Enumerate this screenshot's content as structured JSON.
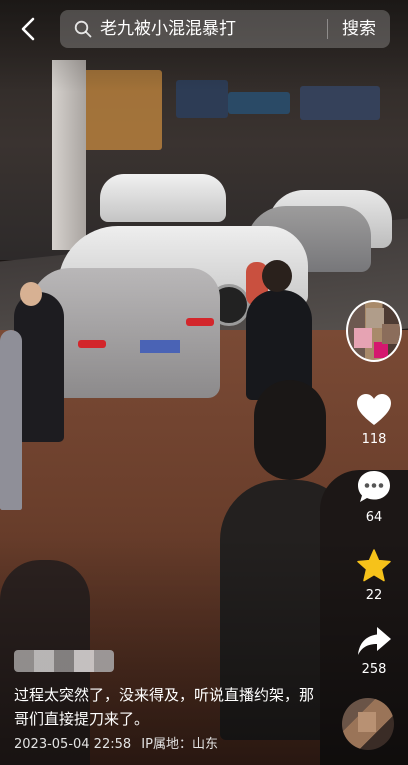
{
  "search": {
    "query": "老九被小混混暴打",
    "submit_label": "搜索"
  },
  "actions": {
    "like_count": "118",
    "comment_count": "64",
    "favorite_count": "22",
    "share_count": "258"
  },
  "post": {
    "caption": "过程太突然了，没来得及，听说直播约架，那哥们直接提刀来了。",
    "date": "2023-05-04 22:58",
    "ip_location": "IP属地：山东"
  },
  "colors": {
    "favorite_active": "#f6c21a",
    "text": "#ffffff"
  },
  "icons": {
    "back": "chevron-left-icon",
    "search": "search-icon",
    "like": "heart-icon",
    "comment": "comment-bubble-icon",
    "favorite": "star-icon",
    "share": "share-arrow-icon"
  }
}
